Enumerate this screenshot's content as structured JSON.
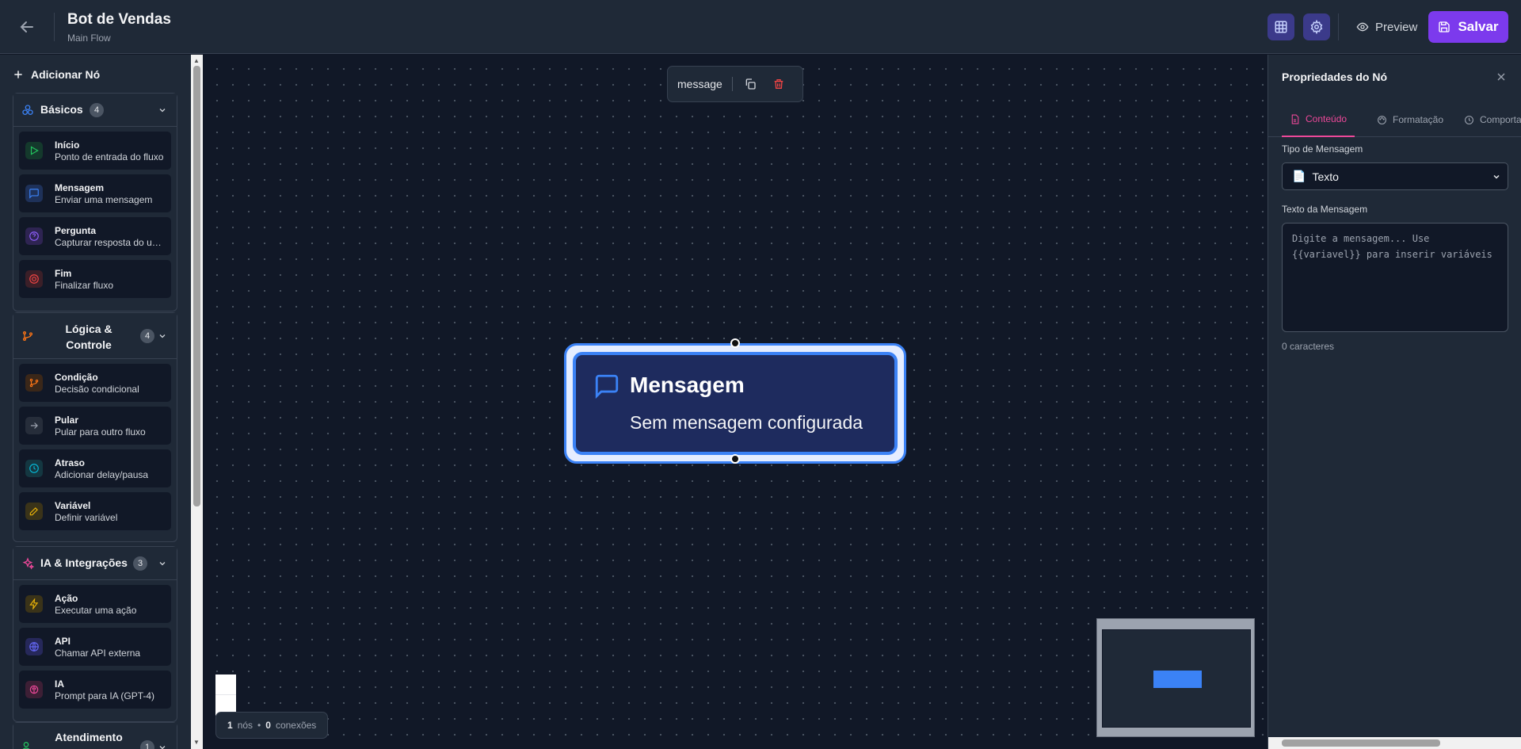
{
  "header": {
    "title": "Bot de Vendas",
    "subtitle": "Main Flow",
    "preview_label": "Preview",
    "save_label": "Salvar"
  },
  "sidebar": {
    "add_node_label": "Adicionar Nó",
    "sections": [
      {
        "title": "Básicos",
        "count": "4",
        "items": [
          {
            "name": "Início",
            "desc": "Ponto de entrada do fluxo",
            "icon": "play-icon",
            "color": "#22c55e"
          },
          {
            "name": "Mensagem",
            "desc": "Enviar uma mensagem",
            "icon": "message-icon",
            "color": "#3b82f6"
          },
          {
            "name": "Pergunta",
            "desc": "Capturar resposta do usuário",
            "icon": "question-icon",
            "color": "#8b5cf6"
          },
          {
            "name": "Fim",
            "desc": "Finalizar fluxo",
            "icon": "target-icon",
            "color": "#ef4444"
          }
        ]
      },
      {
        "title_line1": "Lógica &",
        "title_line2": "Controle",
        "count": "4",
        "items": [
          {
            "name": "Condição",
            "desc": "Decisão condicional",
            "icon": "branch-icon",
            "color": "#f97316"
          },
          {
            "name": "Pular",
            "desc": "Pular para outro fluxo",
            "icon": "arrow-right-icon",
            "color": "#9ca3af"
          },
          {
            "name": "Atraso",
            "desc": "Adicionar delay/pausa",
            "icon": "clock-icon",
            "color": "#06b6d4"
          },
          {
            "name": "Variável",
            "desc": "Definir variável",
            "icon": "pencil-icon",
            "color": "#eab308"
          }
        ]
      },
      {
        "title": "IA & Integrações",
        "count": "3",
        "items": [
          {
            "name": "Ação",
            "desc": "Executar uma ação",
            "icon": "lightning-icon",
            "color": "#eab308"
          },
          {
            "name": "API",
            "desc": "Chamar API externa",
            "icon": "globe-icon",
            "color": "#6366f1"
          },
          {
            "name": "IA",
            "desc": "Prompt para IA (GPT-4)",
            "icon": "brain-icon",
            "color": "#ec4899"
          }
        ]
      },
      {
        "title": "Atendimento",
        "count": "1"
      }
    ]
  },
  "canvas": {
    "toolbar_label": "message",
    "node": {
      "title": "Mensagem",
      "text": "Sem mensagem configurada"
    },
    "stats": {
      "nodes": "1",
      "nodes_label": "nós",
      "separator": "•",
      "connections": "0",
      "connections_label": "conexões"
    }
  },
  "properties": {
    "title": "Propriedades do Nó",
    "tabs": [
      "Conteúdo",
      "Formatação",
      "Comportamento"
    ],
    "message_type_label": "Tipo de Mensagem",
    "message_type_value": "Texto",
    "message_text_label": "Texto da Mensagem",
    "message_text_placeholder": "Digite a mensagem... Use {{variavel}} para inserir variáveis",
    "char_count": "0 caracteres"
  }
}
